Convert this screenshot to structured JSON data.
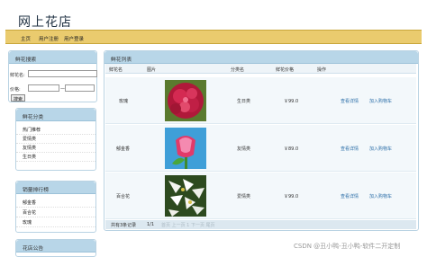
{
  "site_title": "网上花店",
  "nav": [
    "主页",
    "用户注册",
    "用户登录"
  ],
  "search_panel": {
    "title": "鲜花搜索",
    "name_label": "鲜花名:",
    "price_label": "价格:",
    "price_sep": "—",
    "search_button": "搜索"
  },
  "category_panel": {
    "title": "鲜花分类",
    "items": [
      "热门推荐",
      "爱情类",
      "友情类",
      "生日类"
    ]
  },
  "ranking_panel": {
    "title": "销量排行榜",
    "items": [
      "郁金香",
      "百合花",
      "玫瑰"
    ]
  },
  "notice_panel": {
    "title": "花店公告"
  },
  "list_panel": {
    "title": "鲜花列表",
    "headers": [
      "鲜花名",
      "图片",
      "分类名",
      "鲜花价格",
      "操作"
    ],
    "rows": [
      {
        "name": "玫瑰",
        "category": "生日类",
        "price": "￥99.0",
        "detail": "查看详情",
        "cart": "加入购物车",
        "img": "rose"
      },
      {
        "name": "郁金香",
        "category": "友情类",
        "price": "￥89.0",
        "detail": "查看详情",
        "cart": "加入购物车",
        "img": "tulip"
      },
      {
        "name": "百合花",
        "category": "爱情类",
        "price": "￥99.0",
        "detail": "查看详情",
        "cart": "加入购物车",
        "img": "lily"
      }
    ],
    "footer": {
      "total": "共有3条记录",
      "page": "1/1",
      "page_links": "首页 上一页 1 下一页 尾页"
    }
  },
  "watermark": "CSDN @丑小鸭-丑小鸭-软件二开定制"
}
